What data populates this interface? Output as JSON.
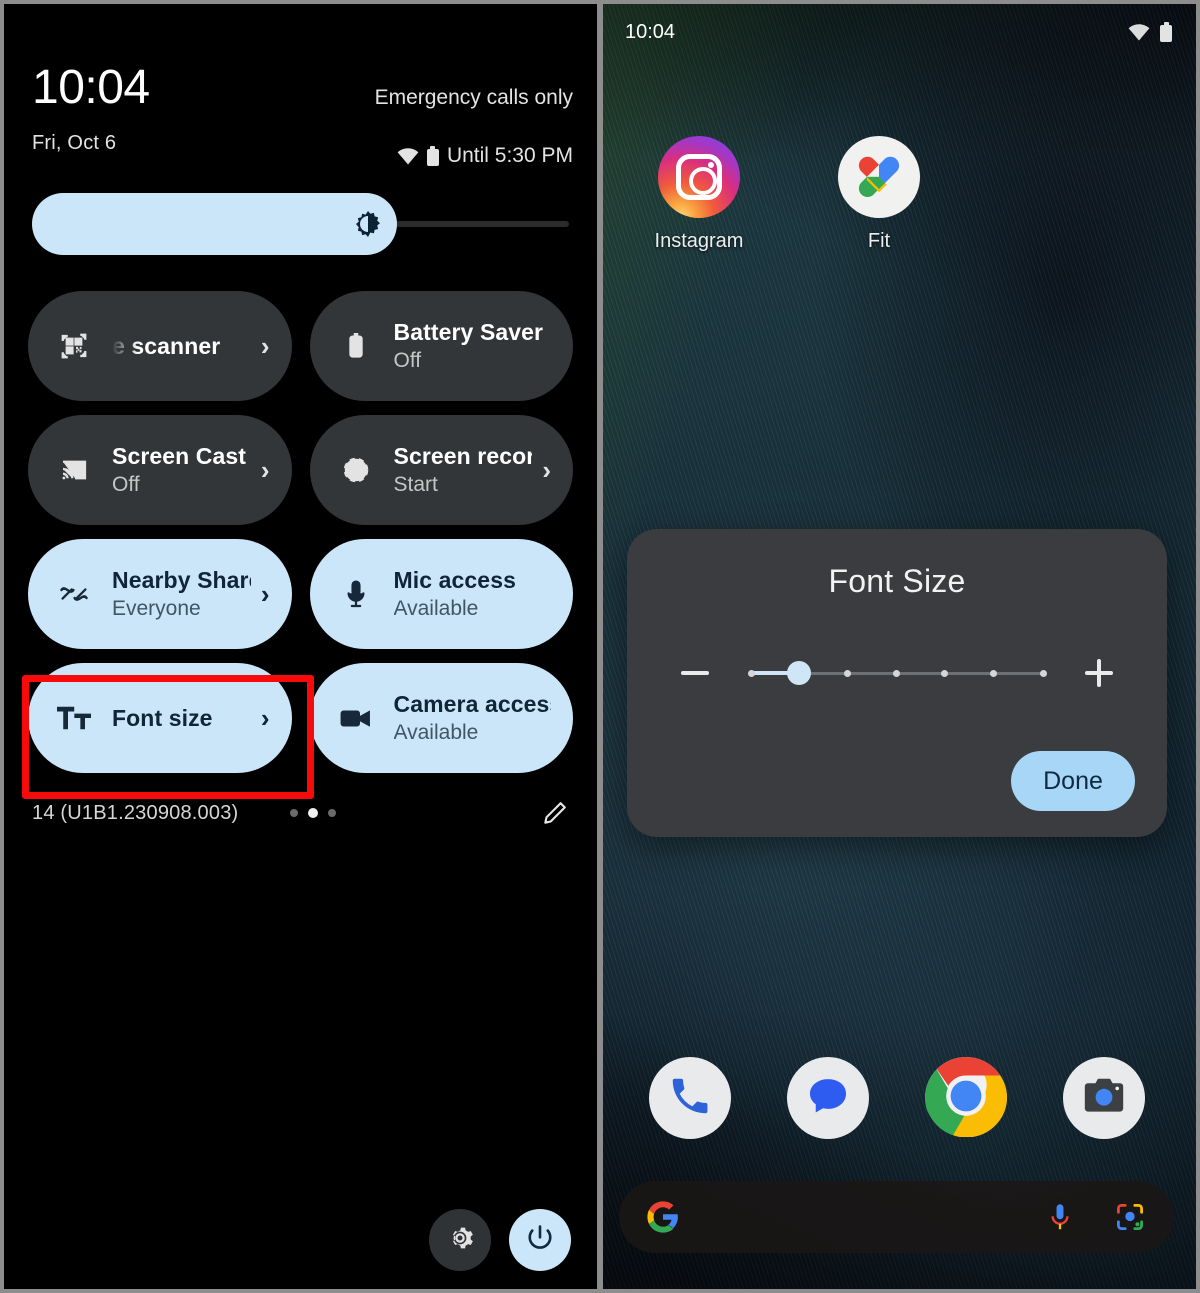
{
  "quick_settings": {
    "clock": "10:04",
    "date": "Fri, Oct 6",
    "carrier": "Emergency calls only",
    "battery_status": "Until 5:30 PM",
    "wifi_icon": "wifi-icon",
    "battery_icon": "battery-icon",
    "brightness": {
      "icon": "brightness-icon",
      "level_percent": 68
    },
    "tiles": [
      {
        "title": "e scanner",
        "subtitle": "",
        "state": "off",
        "icon": "qr-code-scanner-icon",
        "chevron": "›",
        "truncated": true
      },
      {
        "title": "Battery Saver",
        "subtitle": "Off",
        "state": "off",
        "icon": "battery-saver-icon",
        "chevron": ""
      },
      {
        "title": "Screen Cast",
        "subtitle": "Off",
        "state": "off",
        "icon": "screen-cast-icon",
        "chevron": "›"
      },
      {
        "title": "Screen record",
        "subtitle": "Start",
        "state": "off",
        "icon": "screen-record-icon",
        "chevron": "›"
      },
      {
        "title": "Nearby Share",
        "subtitle": "Everyone",
        "state": "on",
        "icon": "nearby-share-icon",
        "chevron": "›"
      },
      {
        "title": "Mic access",
        "subtitle": "Available",
        "state": "on",
        "icon": "microphone-icon",
        "chevron": ""
      },
      {
        "title": "Font size",
        "subtitle": "",
        "state": "on",
        "icon": "font-size-icon",
        "chevron": "›",
        "highlighted": true
      },
      {
        "title": "Camera access",
        "subtitle": "Available",
        "state": "on",
        "icon": "camera-icon",
        "chevron": ""
      }
    ],
    "build_version": "14 (U1B1.230908.003)",
    "page_dots": {
      "count": 3,
      "active_index": 1
    },
    "edit_icon": "pencil-edit-icon",
    "settings_icon": "gear-icon",
    "power_icon": "power-icon",
    "highlight_color": "#f60a0a"
  },
  "home_screen": {
    "status_time": "10:04",
    "wifi_icon": "wifi-icon",
    "battery_icon": "battery-icon",
    "apps": [
      {
        "label": "Instagram",
        "icon": "instagram-icon"
      },
      {
        "label": "Fit",
        "icon": "google-fit-icon"
      }
    ],
    "dock": [
      {
        "icon": "phone-icon",
        "name": "Phone"
      },
      {
        "icon": "messages-icon",
        "name": "Messages"
      },
      {
        "icon": "chrome-icon",
        "name": "Chrome"
      },
      {
        "icon": "camera-icon",
        "name": "Camera"
      }
    ],
    "search_bar": {
      "google_icon": "google-g-icon",
      "mic_icon": "microphone-icon",
      "lens_icon": "google-lens-icon",
      "placeholder": ""
    },
    "font_size_dialog": {
      "title": "Font Size",
      "decrease_label": "−",
      "increase_label": "+",
      "done_label": "Done",
      "slider": {
        "ticks": 7,
        "value_index": 1,
        "accent_color": "#cfe6f7"
      }
    }
  }
}
